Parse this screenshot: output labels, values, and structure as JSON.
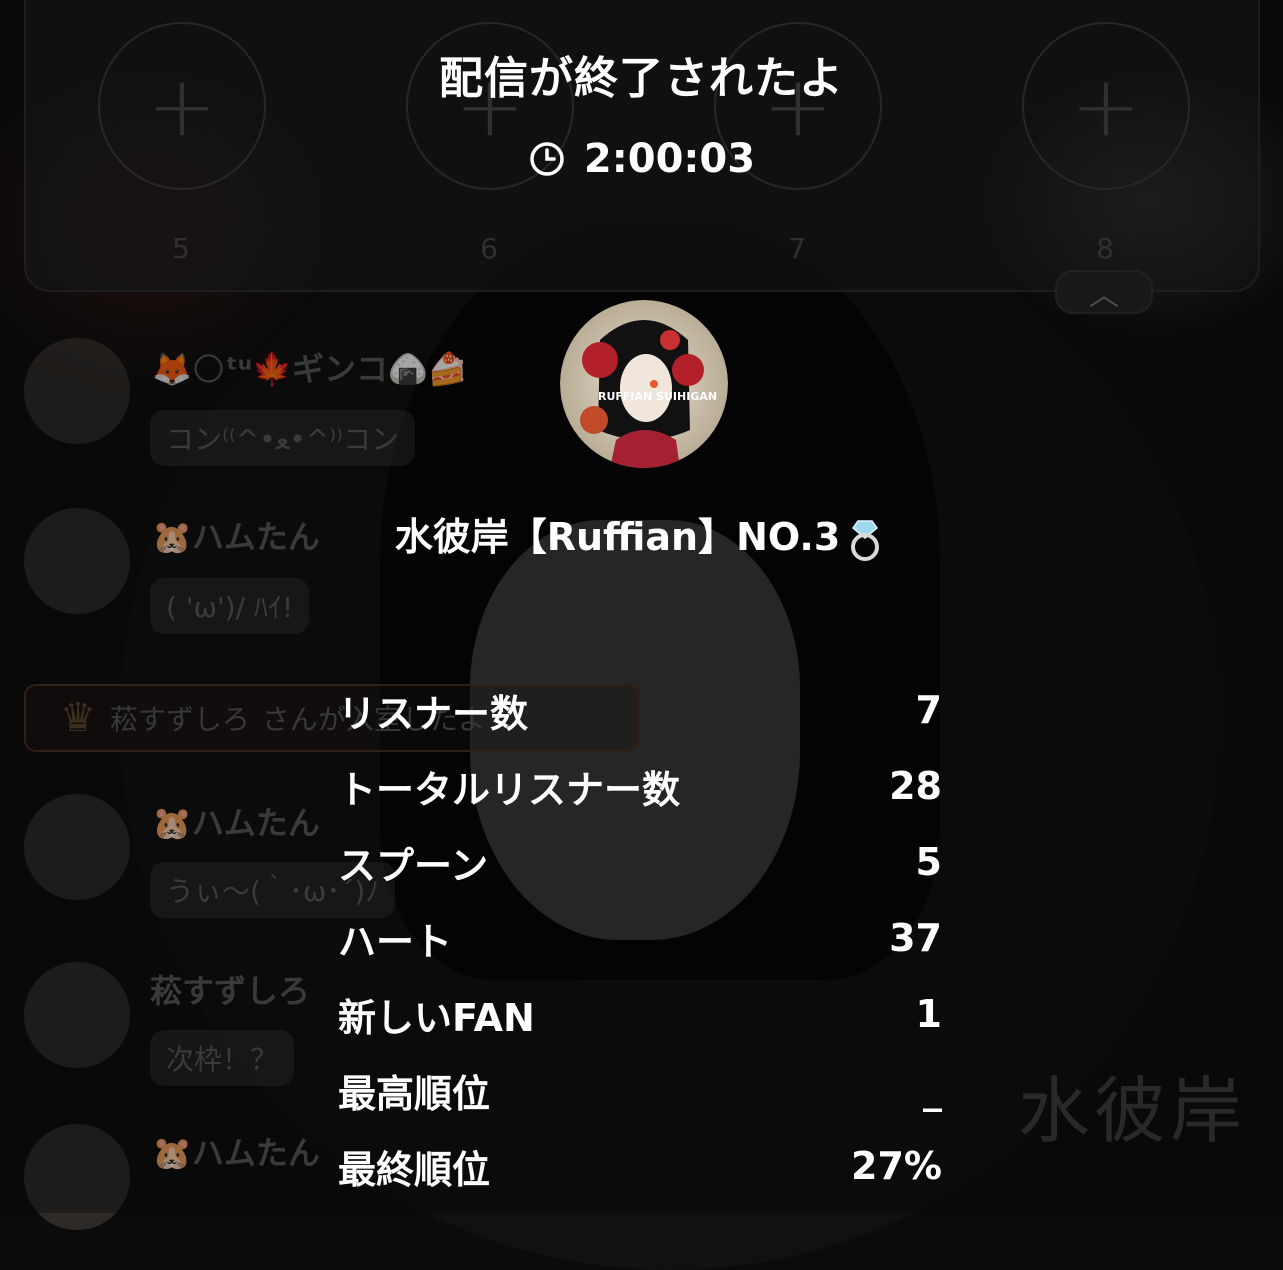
{
  "background": {
    "slots": [
      {
        "number": "5"
      },
      {
        "number": "6"
      },
      {
        "number": "7"
      },
      {
        "number": "8"
      }
    ],
    "chat": [
      {
        "name": "🦊🌕ᵗᵘ🍁ギンコ🍙🍰",
        "message": "コン⁽⁽^•ﻌ•^⁾⁾コン"
      },
      {
        "name": "🐹ハムたん",
        "message": "( 'ω')/ ﾊｲ!"
      },
      {
        "name": "🐹ハムたん",
        "message": "うぃ〜(｀･ω･´)ﾉ"
      },
      {
        "name": "菘すずしろ",
        "message": "次枠！？"
      },
      {
        "name": "🐹ハムたん",
        "message": ""
      }
    ],
    "entry_banner": {
      "name": "菘すずしろ",
      "text": "さんが入室したよ"
    },
    "watermark": "水彼岸"
  },
  "dialog": {
    "title": "配信が終了されたよ",
    "duration": "2:00:03",
    "host_name": "水彼岸【Ruffian】NO.3",
    "avatar_text": "RUFFIAN SUIHIGAN",
    "stats": [
      {
        "label": "リスナー数",
        "value": "7"
      },
      {
        "label": "トータルリスナー数",
        "value": "28"
      },
      {
        "label": "スプーン",
        "value": "5"
      },
      {
        "label": "ハート",
        "value": "37"
      },
      {
        "label": "新しいFAN",
        "value": "1"
      },
      {
        "label": "最高順位",
        "value": "_"
      },
      {
        "label": "最終順位",
        "value": "27%"
      }
    ]
  }
}
